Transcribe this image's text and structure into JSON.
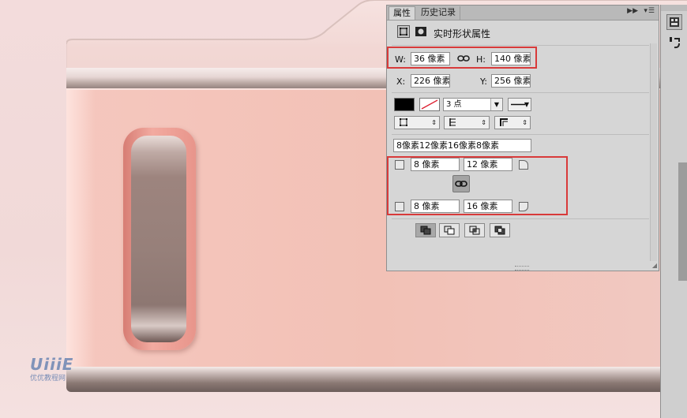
{
  "panel": {
    "tabs": [
      {
        "label": "属性",
        "active": true
      },
      {
        "label": "历史记录",
        "active": false
      }
    ],
    "menu_icon": "panel-menu-icon",
    "collapse_icon": "double-chevron-right-icon",
    "shape_title": "实时形状属性",
    "size": {
      "w_label": "W:",
      "w_value": "36 像素",
      "h_label": "H:",
      "h_value": "140 像素"
    },
    "position": {
      "x_label": "X:",
      "x_value": "226 像素",
      "y_label": "Y:",
      "y_value": "256 像素"
    },
    "stroke": {
      "fill_color": "#000000",
      "width_value": "3 点"
    },
    "corners_summary": "8像素12像素16像素8像素",
    "corners": {
      "top_left": "8 像素",
      "top_right": "12 像素",
      "bottom_left": "8 像素",
      "bottom_right": "16 像素"
    },
    "highlight_color": "#d83a3a"
  },
  "watermark": {
    "logo": "UiiiE",
    "subtitle": "优优教程网"
  }
}
